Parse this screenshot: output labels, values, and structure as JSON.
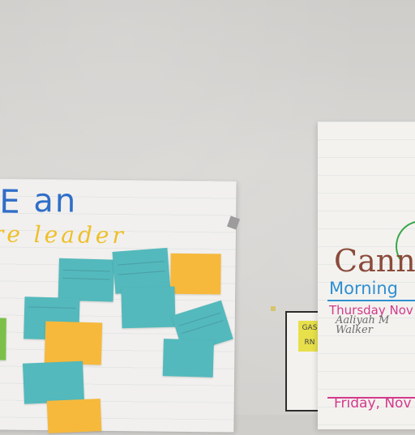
{
  "left_chart": {
    "title_letter": "E",
    "title_word": "an",
    "subtitle": "re leader"
  },
  "right_chart": {
    "title": "Canne",
    "heading": "Morning",
    "day1": "Thursday Nov",
    "names": [
      "Aaliyah M",
      "Walker"
    ],
    "day2": "Friday, Nov"
  },
  "sign_text": [
    "GAS",
    "RN"
  ],
  "colors": {
    "sticky_teal": "#53b9bc",
    "sticky_orange": "#f6b93c",
    "sticky_green": "#7cc04a",
    "title_blue": "#2f6ec9",
    "leader_yellow": "#efbf2a",
    "thursday_pink": "#d33a8b",
    "morning_blue": "#2f8fd1"
  }
}
